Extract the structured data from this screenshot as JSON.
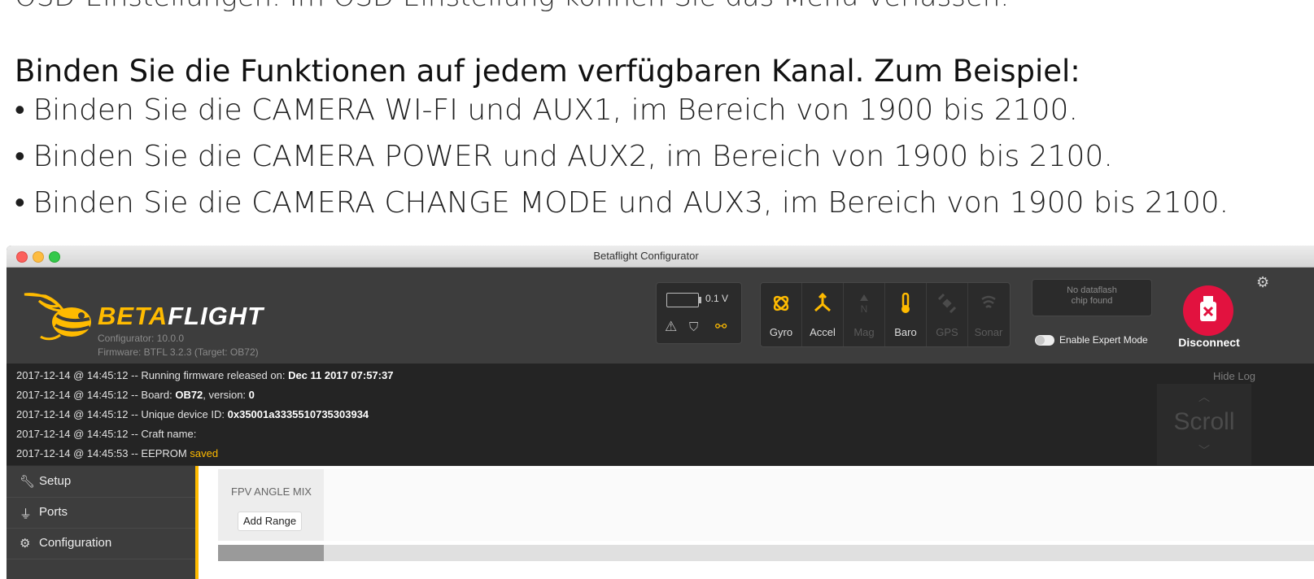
{
  "document": {
    "intro_line": "OSD-Einstellungen. Im OSD Einstellung können Sie das Menü verlassen.",
    "heading": "Binden Sie die Funktionen auf jedem verfügbaren Kanal. Zum Beispiel:",
    "bullets": [
      "Binden Sie die CAMERA WI-FI und AUX1, im Bereich von 1900 bis 2100.",
      "Binden Sie die CAMERA POWER und AUX2, im Bereich von 1900 bis 2100.",
      "Binden Sie die CAMERA CHANGE MODE und AUX3, im Bereich von 1900 bis 2100."
    ]
  },
  "window": {
    "title": "Betaflight Configurator"
  },
  "header": {
    "brand_part1": "BETA",
    "brand_part2": "FLIGHT",
    "configurator_version": "Configurator: 10.0.0",
    "firmware_version": "Firmware: BTFL 3.2.3 (Target: OB72)",
    "voltage": "0.1 V",
    "status_icons": [
      "warning-icon",
      "parachute-icon",
      "link-icon"
    ],
    "sensors": [
      {
        "label": "Gyro",
        "active": true,
        "icon": "gyro-icon"
      },
      {
        "label": "Accel",
        "active": true,
        "icon": "accel-icon"
      },
      {
        "label": "Mag",
        "active": false,
        "icon": "mag-icon"
      },
      {
        "label": "Baro",
        "active": true,
        "icon": "baro-icon"
      },
      {
        "label": "GPS",
        "active": false,
        "icon": "gps-icon"
      },
      {
        "label": "Sonar",
        "active": false,
        "icon": "sonar-icon"
      }
    ],
    "dataflash_line1": "No dataflash",
    "dataflash_line2": "chip found",
    "expert_mode_label": "Enable Expert Mode",
    "disconnect_label": "Disconnect",
    "accent_color": "#ffbb00",
    "disconnect_color": "#e2123f"
  },
  "log": {
    "hide_label": "Hide Log",
    "scroll_label": "Scroll",
    "lines": [
      {
        "prefix": "2017-12-14 @ 14:45:12 -- Running firmware released on: ",
        "bold": "Dec 11 2017 07:57:37",
        "suffix": ""
      },
      {
        "prefix": "2017-12-14 @ 14:45:12 -- Board: ",
        "bold": "OB72",
        "suffix": ", version: ",
        "bold2": "0"
      },
      {
        "prefix": "2017-12-14 @ 14:45:12 -- Unique device ID: ",
        "bold": "0x35001a3335510735303934",
        "suffix": ""
      },
      {
        "prefix": "2017-12-14 @ 14:45:12 -- Craft name:",
        "bold": "",
        "suffix": ""
      },
      {
        "prefix": "2017-12-14 @ 14:45:53 -- EEPROM ",
        "highlight": "saved"
      }
    ]
  },
  "sidebar": {
    "items": [
      {
        "label": "Setup",
        "icon": "wrench-icon"
      },
      {
        "label": "Ports",
        "icon": "plug-icon"
      },
      {
        "label": "Configuration",
        "icon": "gear-icon"
      }
    ]
  },
  "modes": {
    "mode_name": "FPV ANGLE MIX",
    "add_range_label": "Add Range"
  }
}
